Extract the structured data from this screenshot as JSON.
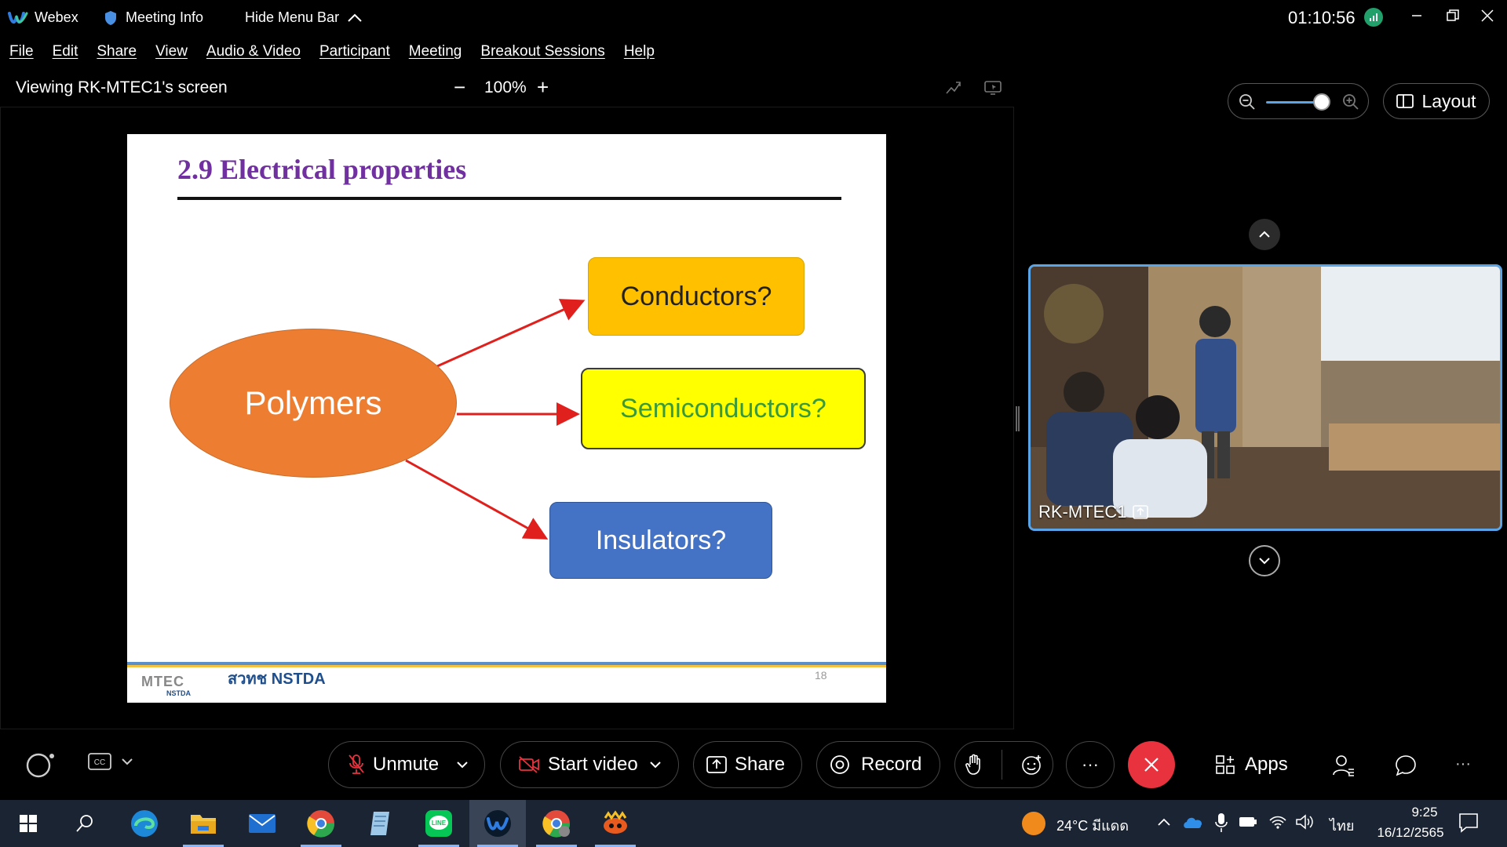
{
  "titlebar": {
    "app_name": "Webex",
    "meeting_info": "Meeting Info",
    "hide_menu": "Hide Menu Bar",
    "timer": "01:10:56"
  },
  "menubar": {
    "items": [
      "File",
      "Edit",
      "Share",
      "View",
      "Audio & Video",
      "Participant",
      "Meeting",
      "Breakout Sessions",
      "Help"
    ]
  },
  "viewbar": {
    "label": "Viewing RK-MTEC1's screen",
    "zoom": "100%",
    "zoom_out": "−",
    "zoom_in": "+"
  },
  "slide": {
    "title": "2.9 Electrical properties",
    "center": "Polymers",
    "targets": [
      "Conductors?",
      "Semiconductors?",
      "Insulators?"
    ],
    "page_number": "18",
    "logo_left": "MTEC",
    "logo_left_sub": "NSTDA",
    "logo_right": "สวทช NSTDA"
  },
  "right_panel": {
    "layout_label": "Layout",
    "participant_name": "RK-MTEC1"
  },
  "controls": {
    "unmute": "Unmute",
    "start_video": "Start video",
    "share": "Share",
    "record": "Record",
    "more": "···",
    "apps": "Apps",
    "overflow": "···"
  },
  "taskbar": {
    "weather": "24°C มีแดด",
    "language": "ไทย",
    "time": "9:25",
    "date": "16/12/2565"
  },
  "colors": {
    "accent_blue": "#5aa4e8",
    "leave_red": "#e8323e",
    "slide_title": "#7030a0",
    "arrow": "#e0201c"
  }
}
